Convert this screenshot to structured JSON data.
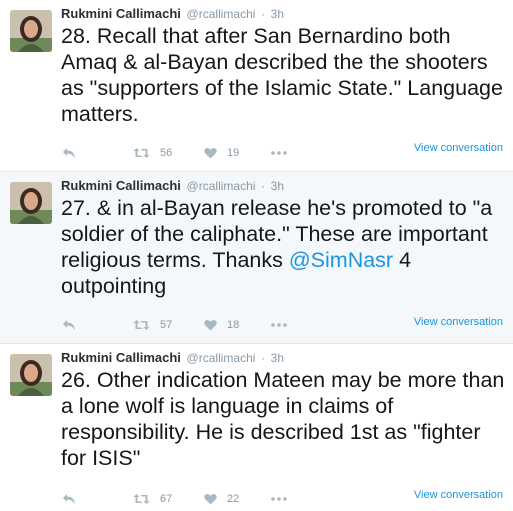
{
  "tweets": [
    {
      "name": "Rukmini Callimachi",
      "handle": "@rcallimachi",
      "dot": "·",
      "time": "3h",
      "text_before": "28. Recall that after San Bernardino both Amaq & al-Bayan described the the shooters as \"supporters of the Islamic State.\" Language matters.",
      "mention": "",
      "text_after": "",
      "retweets": "56",
      "likes": "19",
      "view_conversation": "View conversation"
    },
    {
      "name": "Rukmini Callimachi",
      "handle": "@rcallimachi",
      "dot": "·",
      "time": "3h",
      "text_before": "27. & in al-Bayan release he's promoted to \"a soldier of the caliphate.\" These are important religious terms. Thanks ",
      "mention": "@SimNasr",
      "text_after": " 4 outpointing",
      "retweets": "57",
      "likes": "18",
      "view_conversation": "View conversation"
    },
    {
      "name": "Rukmini Callimachi",
      "handle": "@rcallimachi",
      "dot": "·",
      "time": "3h",
      "text_before": "26. Other indication Mateen may be more than a lone wolf is language in claims of responsibility. He is described 1st as \"fighter for ISIS\"",
      "mention": "",
      "text_after": "",
      "retweets": "67",
      "likes": "22",
      "view_conversation": "View conversation"
    }
  ],
  "icons": {
    "reply": "reply-icon",
    "retweet": "retweet-icon",
    "like": "heart-icon",
    "more": "more-icon"
  },
  "colors": {
    "link": "#1b95e0",
    "icon": "#aab8c2",
    "muted": "#8899a6",
    "highlight_bg": "#f5f8fa"
  }
}
